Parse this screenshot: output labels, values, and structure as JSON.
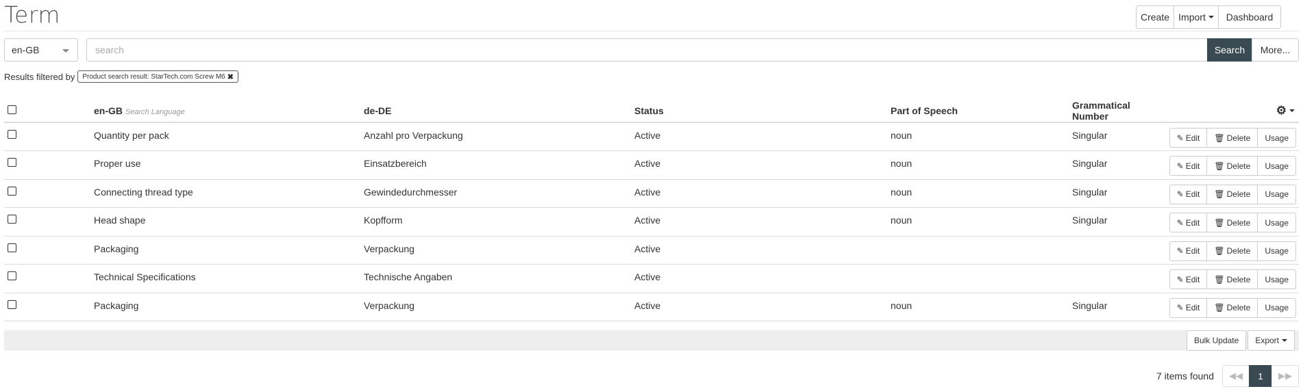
{
  "page": {
    "title": "Term"
  },
  "toolbar": {
    "create_label": "Create",
    "import_label": "Import",
    "dashboard_label": "Dashboard"
  },
  "search": {
    "language": "en-GB",
    "placeholder": "search",
    "value": "",
    "search_label": "Search",
    "more_label": "More..."
  },
  "filter": {
    "prefix": "Results filtered by",
    "tag": "Product search result: StarTech.com Screw M6"
  },
  "table": {
    "headers": {
      "source_lang": "en-GB",
      "source_hint": "Search Language",
      "target_lang": "de-DE",
      "status": "Status",
      "pos": "Part of Speech",
      "number": "Grammatical Number"
    },
    "action_labels": {
      "edit": "Edit",
      "delete": "Delete",
      "usage": "Usage"
    },
    "rows": [
      {
        "source": "Quantity per pack",
        "target": "Anzahl pro Verpackung",
        "status": "Active",
        "pos": "noun",
        "number": "Singular"
      },
      {
        "source": "Proper use",
        "target": "Einsatzbereich",
        "status": "Active",
        "pos": "noun",
        "number": "Singular"
      },
      {
        "source": "Connecting thread type",
        "target": "Gewindedurchmesser",
        "status": "Active",
        "pos": "noun",
        "number": "Singular"
      },
      {
        "source": "Head shape",
        "target": "Kopfform",
        "status": "Active",
        "pos": "noun",
        "number": "Singular"
      },
      {
        "source": "Packaging",
        "target": "Verpackung",
        "status": "Active",
        "pos": "",
        "number": ""
      },
      {
        "source": "Technical Specifications",
        "target": "Technische Angaben",
        "status": "Active",
        "pos": "",
        "number": ""
      },
      {
        "source": "Packaging",
        "target": "Verpackung",
        "status": "Active",
        "pos": "noun",
        "number": "Singular"
      }
    ]
  },
  "bulk": {
    "bulk_update_label": "Bulk Update",
    "export_label": "Export"
  },
  "pagination": {
    "found_text": "7 items found",
    "current_page": "1",
    "prev_icon": "◀◀",
    "next_icon": "▶▶"
  },
  "colors": {
    "primary_dark": "#3a4a52",
    "border": "#cccccc",
    "bulk_bar": "#eeeeee"
  },
  "icons": {
    "edit": "pencil-icon",
    "delete": "trash-icon",
    "settings": "gear-icon",
    "remove_filter": "close-icon"
  }
}
